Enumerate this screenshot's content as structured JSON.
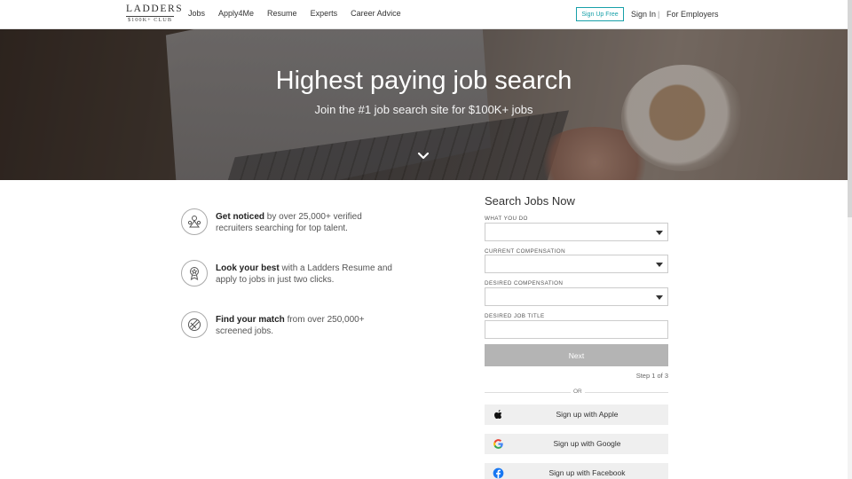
{
  "header": {
    "logo_main": "LADDERS",
    "logo_sub": "$100K+ CLUB",
    "nav": [
      "Jobs",
      "Apply4Me",
      "Resume",
      "Experts",
      "Career Advice"
    ],
    "signup_free": "Sign Up Free",
    "signin": "Sign In",
    "separator": "|",
    "employers": "For Employers"
  },
  "hero": {
    "title": "Highest paying job search",
    "subtitle": "Join the #1 job search site for $100K+ jobs"
  },
  "features": [
    {
      "bold": "Get noticed",
      "rest": " by over 25,000+ verified recruiters searching for top talent.",
      "icon": "recruiter-icon"
    },
    {
      "bold": "Look your best",
      "rest": " with a Ladders Resume and apply to jobs in just two clicks.",
      "icon": "award-ribbon-icon"
    },
    {
      "bold": "Find your match",
      "rest": " from over 250,000+ screened jobs.",
      "icon": "target-match-icon"
    }
  ],
  "form": {
    "title": "Search Jobs Now",
    "what_you_do": "WHAT YOU DO",
    "current_comp": "CURRENT COMPENSATION",
    "desired_comp": "DESIRED COMPENSATION",
    "desired_title": "DESIRED JOB TITLE",
    "next": "Next",
    "step": "Step 1 of 3",
    "or": "OR"
  },
  "social": {
    "apple": "Sign up with Apple",
    "google": "Sign up with Google",
    "facebook": "Sign up with Facebook"
  },
  "colors": {
    "accent": "#18a0a9",
    "next_button": "#b4b4b4",
    "facebook": "#1877f2"
  }
}
